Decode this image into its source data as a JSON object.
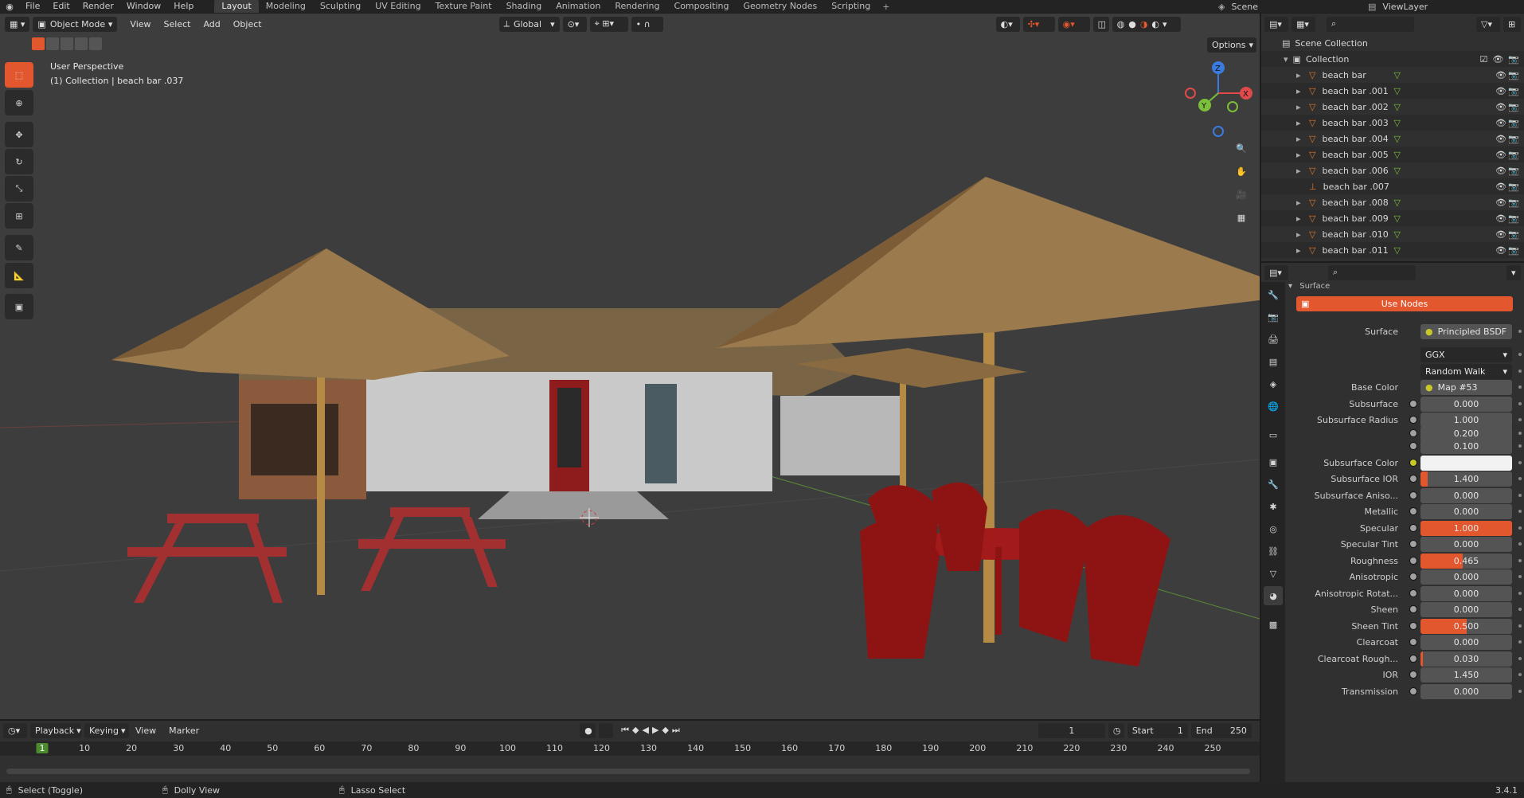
{
  "topbar": {
    "menus": [
      "File",
      "Edit",
      "Render",
      "Window",
      "Help"
    ],
    "workspaces": [
      "Layout",
      "Modeling",
      "Sculpting",
      "UV Editing",
      "Texture Paint",
      "Shading",
      "Animation",
      "Rendering",
      "Compositing",
      "Geometry Nodes",
      "Scripting"
    ],
    "active_workspace": "Layout",
    "scene": "Scene",
    "view_layer": "ViewLayer"
  },
  "viewport": {
    "mode": "Object Mode",
    "menus": [
      "View",
      "Select",
      "Add",
      "Object"
    ],
    "orientation": "Global",
    "options_label": "Options",
    "overlay_title": "User Perspective",
    "overlay_subtitle": "(1) Collection | beach bar .037",
    "gizmo_axes": {
      "x": "X",
      "y": "Y",
      "z": "Z"
    }
  },
  "outliner": {
    "scene_collection": "Scene Collection",
    "collection": "Collection",
    "items": [
      "beach bar",
      "beach bar .001",
      "beach bar .002",
      "beach bar .003",
      "beach bar .004",
      "beach bar .005",
      "beach bar .006",
      "beach bar .007",
      "beach bar .008",
      "beach bar .009",
      "beach bar .010",
      "beach bar .011"
    ]
  },
  "properties": {
    "section": "Surface",
    "use_nodes": "Use Nodes",
    "rows": [
      {
        "label": "Surface",
        "value": "Principled BSDF",
        "kind": "link"
      },
      {
        "label": "",
        "value": "GGX",
        "kind": "dropdown"
      },
      {
        "label": "",
        "value": "Random Walk",
        "kind": "dropdown"
      },
      {
        "label": "Base Color",
        "value": "Map #53",
        "kind": "link"
      },
      {
        "label": "Subsurface",
        "value": "0.000",
        "kind": "num"
      },
      {
        "label": "Subsurface Radius",
        "value": "1.000",
        "kind": "num"
      },
      {
        "label": "",
        "value": "0.200",
        "kind": "num"
      },
      {
        "label": "",
        "value": "0.100",
        "kind": "num"
      },
      {
        "label": "Subsurface Color",
        "value": "",
        "kind": "color"
      },
      {
        "label": "Subsurface IOR",
        "value": "1.400",
        "kind": "num"
      },
      {
        "label": "Subsurface Aniso...",
        "value": "0.000",
        "kind": "num"
      },
      {
        "label": "Metallic",
        "value": "0.000",
        "kind": "num"
      },
      {
        "label": "Specular",
        "value": "1.000",
        "kind": "num"
      },
      {
        "label": "Specular Tint",
        "value": "0.000",
        "kind": "num"
      },
      {
        "label": "Roughness",
        "value": "0.465",
        "kind": "num"
      },
      {
        "label": "Anisotropic",
        "value": "0.000",
        "kind": "num"
      },
      {
        "label": "Anisotropic Rotat...",
        "value": "0.000",
        "kind": "num"
      },
      {
        "label": "Sheen",
        "value": "0.000",
        "kind": "num"
      },
      {
        "label": "Sheen Tint",
        "value": "0.500",
        "kind": "num"
      },
      {
        "label": "Clearcoat",
        "value": "0.000",
        "kind": "num"
      },
      {
        "label": "Clearcoat Rough...",
        "value": "0.030",
        "kind": "num"
      },
      {
        "label": "IOR",
        "value": "1.450",
        "kind": "num"
      },
      {
        "label": "Transmission",
        "value": "0.000",
        "kind": "num"
      }
    ]
  },
  "timeline": {
    "menus": [
      "Playback",
      "Keying",
      "View",
      "Marker"
    ],
    "current_frame": "1",
    "start_label": "Start",
    "start": "1",
    "end_label": "End",
    "end": "250",
    "ruler": [
      "1",
      "10",
      "20",
      "30",
      "40",
      "50",
      "60",
      "70",
      "80",
      "90",
      "100",
      "110",
      "120",
      "130",
      "140",
      "150",
      "160",
      "170",
      "180",
      "190",
      "200",
      "210",
      "220",
      "230",
      "240",
      "250"
    ]
  },
  "statusbar": {
    "left": "Select (Toggle)",
    "middle": "Dolly View",
    "right": "Lasso Select",
    "version": "3.4.1"
  },
  "colors": {
    "accent": "#4772b3",
    "orange": "#e2572e",
    "bg": "#3d3d3d"
  }
}
